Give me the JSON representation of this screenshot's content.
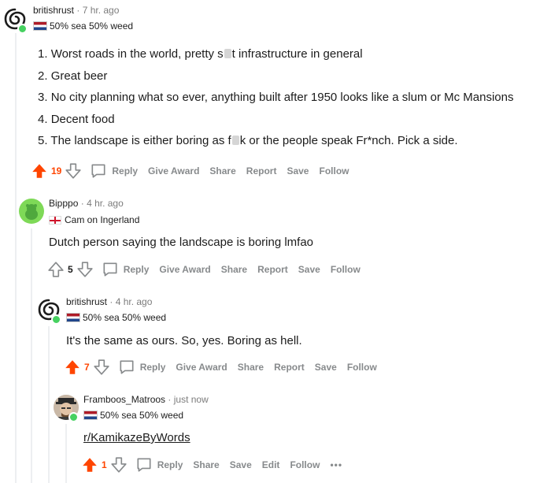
{
  "comments": [
    {
      "username": "britishrust",
      "age": "7 hr. ago",
      "flair": "50% sea 50% weed",
      "list_items": [
        "Worst roads in the world, pretty s",
        "Great beer",
        "No city planning what so ever, anything built after 1950 looks like a slum or Mc Mansions",
        "Decent food",
        "The landscape is either boring as f"
      ],
      "list_tail_1": "t infrastructure in general",
      "list_tail_5": "k or the people speak Fr*nch. Pick a side.",
      "score": "19",
      "actions": {
        "reply": "Reply",
        "give_award": "Give Award",
        "share": "Share",
        "report": "Report",
        "save": "Save",
        "follow": "Follow"
      }
    },
    {
      "username": "Bipppo",
      "age": "4 hr. ago",
      "flair": "Cam on Ingerland",
      "body": "Dutch person saying the landscape is boring lmfao",
      "score": "5",
      "actions": {
        "reply": "Reply",
        "give_award": "Give Award",
        "share": "Share",
        "report": "Report",
        "save": "Save",
        "follow": "Follow"
      }
    },
    {
      "username": "britishrust",
      "age": "4 hr. ago",
      "flair": "50% sea 50% weed",
      "body": "It's the same as ours. So, yes. Boring as hell.",
      "score": "7",
      "actions": {
        "reply": "Reply",
        "give_award": "Give Award",
        "share": "Share",
        "report": "Report",
        "save": "Save",
        "follow": "Follow"
      }
    },
    {
      "username": "Framboos_Matroos",
      "age": "just now",
      "flair": "50% sea 50% weed",
      "link": "r/KamikazeByWords",
      "score": "1",
      "actions": {
        "reply": "Reply",
        "share": "Share",
        "save": "Save",
        "edit": "Edit",
        "follow": "Follow",
        "more": "•••"
      }
    }
  ],
  "colors": {
    "upvote": "#ff4500",
    "online": "#46d160",
    "meta_gray": "#7c7c7c",
    "action_gray": "#878a8c"
  },
  "icons": [
    "spiral-avatar-icon",
    "snoo-avatar-icon",
    "upvote-arrow-icon",
    "downvote-arrow-icon",
    "comment-bubble-icon"
  ]
}
